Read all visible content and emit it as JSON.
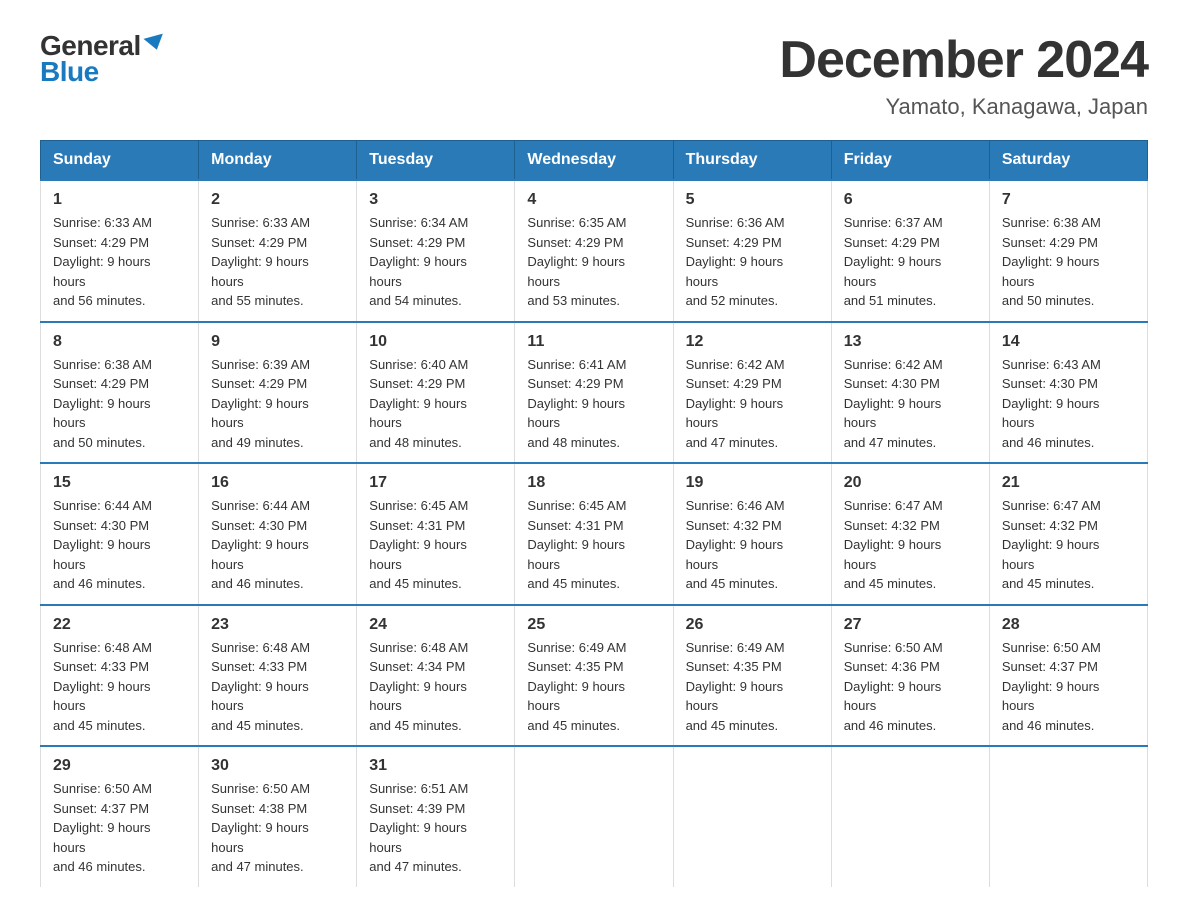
{
  "header": {
    "logo_general": "General",
    "logo_blue": "Blue",
    "month_title": "December 2024",
    "subtitle": "Yamato, Kanagawa, Japan"
  },
  "weekdays": [
    "Sunday",
    "Monday",
    "Tuesday",
    "Wednesday",
    "Thursday",
    "Friday",
    "Saturday"
  ],
  "weeks": [
    [
      {
        "day": "1",
        "sunrise": "6:33 AM",
        "sunset": "4:29 PM",
        "daylight": "9 hours and 56 minutes."
      },
      {
        "day": "2",
        "sunrise": "6:33 AM",
        "sunset": "4:29 PM",
        "daylight": "9 hours and 55 minutes."
      },
      {
        "day": "3",
        "sunrise": "6:34 AM",
        "sunset": "4:29 PM",
        "daylight": "9 hours and 54 minutes."
      },
      {
        "day": "4",
        "sunrise": "6:35 AM",
        "sunset": "4:29 PM",
        "daylight": "9 hours and 53 minutes."
      },
      {
        "day": "5",
        "sunrise": "6:36 AM",
        "sunset": "4:29 PM",
        "daylight": "9 hours and 52 minutes."
      },
      {
        "day": "6",
        "sunrise": "6:37 AM",
        "sunset": "4:29 PM",
        "daylight": "9 hours and 51 minutes."
      },
      {
        "day": "7",
        "sunrise": "6:38 AM",
        "sunset": "4:29 PM",
        "daylight": "9 hours and 50 minutes."
      }
    ],
    [
      {
        "day": "8",
        "sunrise": "6:38 AM",
        "sunset": "4:29 PM",
        "daylight": "9 hours and 50 minutes."
      },
      {
        "day": "9",
        "sunrise": "6:39 AM",
        "sunset": "4:29 PM",
        "daylight": "9 hours and 49 minutes."
      },
      {
        "day": "10",
        "sunrise": "6:40 AM",
        "sunset": "4:29 PM",
        "daylight": "9 hours and 48 minutes."
      },
      {
        "day": "11",
        "sunrise": "6:41 AM",
        "sunset": "4:29 PM",
        "daylight": "9 hours and 48 minutes."
      },
      {
        "day": "12",
        "sunrise": "6:42 AM",
        "sunset": "4:29 PM",
        "daylight": "9 hours and 47 minutes."
      },
      {
        "day": "13",
        "sunrise": "6:42 AM",
        "sunset": "4:30 PM",
        "daylight": "9 hours and 47 minutes."
      },
      {
        "day": "14",
        "sunrise": "6:43 AM",
        "sunset": "4:30 PM",
        "daylight": "9 hours and 46 minutes."
      }
    ],
    [
      {
        "day": "15",
        "sunrise": "6:44 AM",
        "sunset": "4:30 PM",
        "daylight": "9 hours and 46 minutes."
      },
      {
        "day": "16",
        "sunrise": "6:44 AM",
        "sunset": "4:30 PM",
        "daylight": "9 hours and 46 minutes."
      },
      {
        "day": "17",
        "sunrise": "6:45 AM",
        "sunset": "4:31 PM",
        "daylight": "9 hours and 45 minutes."
      },
      {
        "day": "18",
        "sunrise": "6:45 AM",
        "sunset": "4:31 PM",
        "daylight": "9 hours and 45 minutes."
      },
      {
        "day": "19",
        "sunrise": "6:46 AM",
        "sunset": "4:32 PM",
        "daylight": "9 hours and 45 minutes."
      },
      {
        "day": "20",
        "sunrise": "6:47 AM",
        "sunset": "4:32 PM",
        "daylight": "9 hours and 45 minutes."
      },
      {
        "day": "21",
        "sunrise": "6:47 AM",
        "sunset": "4:32 PM",
        "daylight": "9 hours and 45 minutes."
      }
    ],
    [
      {
        "day": "22",
        "sunrise": "6:48 AM",
        "sunset": "4:33 PM",
        "daylight": "9 hours and 45 minutes."
      },
      {
        "day": "23",
        "sunrise": "6:48 AM",
        "sunset": "4:33 PM",
        "daylight": "9 hours and 45 minutes."
      },
      {
        "day": "24",
        "sunrise": "6:48 AM",
        "sunset": "4:34 PM",
        "daylight": "9 hours and 45 minutes."
      },
      {
        "day": "25",
        "sunrise": "6:49 AM",
        "sunset": "4:35 PM",
        "daylight": "9 hours and 45 minutes."
      },
      {
        "day": "26",
        "sunrise": "6:49 AM",
        "sunset": "4:35 PM",
        "daylight": "9 hours and 45 minutes."
      },
      {
        "day": "27",
        "sunrise": "6:50 AM",
        "sunset": "4:36 PM",
        "daylight": "9 hours and 46 minutes."
      },
      {
        "day": "28",
        "sunrise": "6:50 AM",
        "sunset": "4:37 PM",
        "daylight": "9 hours and 46 minutes."
      }
    ],
    [
      {
        "day": "29",
        "sunrise": "6:50 AM",
        "sunset": "4:37 PM",
        "daylight": "9 hours and 46 minutes."
      },
      {
        "day": "30",
        "sunrise": "6:50 AM",
        "sunset": "4:38 PM",
        "daylight": "9 hours and 47 minutes."
      },
      {
        "day": "31",
        "sunrise": "6:51 AM",
        "sunset": "4:39 PM",
        "daylight": "9 hours and 47 minutes."
      },
      null,
      null,
      null,
      null
    ]
  ]
}
